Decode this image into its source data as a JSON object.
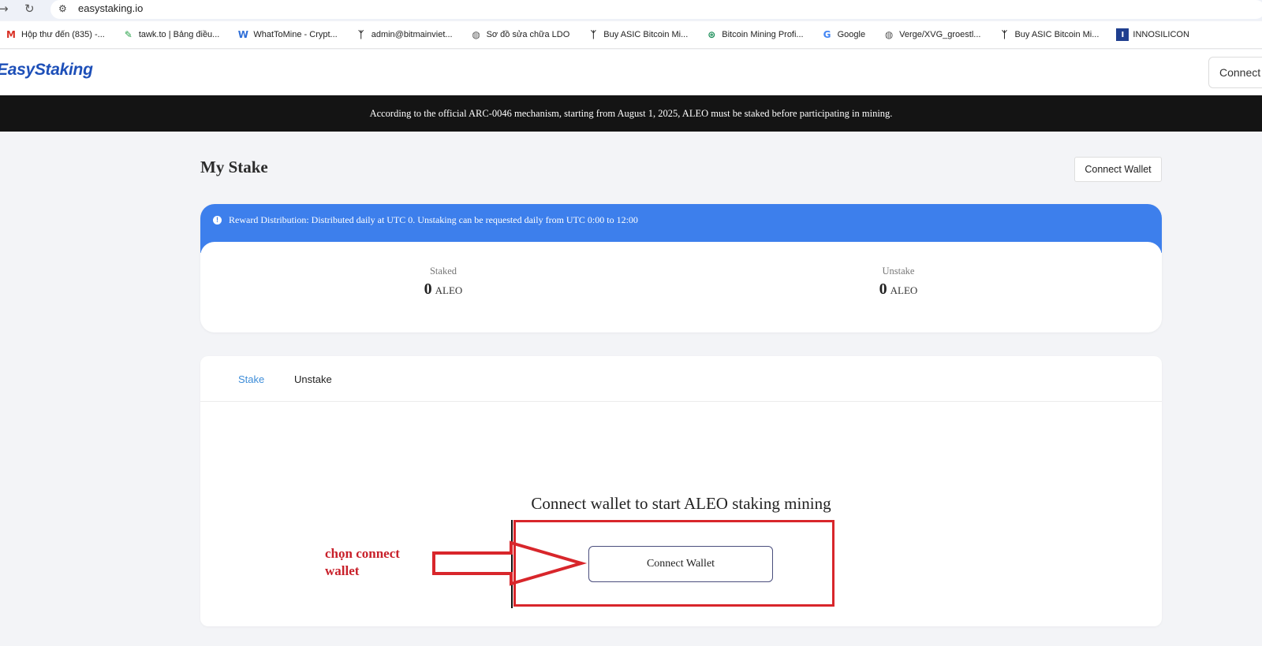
{
  "browser": {
    "url": "easystaking.io",
    "bookmarks": [
      {
        "icon": "gmail-icon",
        "label": "Hộp thư đến (835) -...",
        "color": "#d93025"
      },
      {
        "icon": "tawk-icon",
        "label": "tawk.to | Bảng điều...",
        "color": "#2aa24a"
      },
      {
        "icon": "whattomine-icon",
        "label": "WhatToMine - Crypt...",
        "color": "#2f6fd8"
      },
      {
        "icon": "bitmain-icon",
        "label": "admin@bitmainviet...",
        "color": "#222222"
      },
      {
        "icon": "globe-icon",
        "label": "Sơ đồ sửa chữa LDO",
        "color": "#555555"
      },
      {
        "icon": "bitmain-icon",
        "label": "Buy ASIC Bitcoin Mi...",
        "color": "#222222"
      },
      {
        "icon": "mining-profit-icon",
        "label": "Bitcoin Mining Profi...",
        "color": "#1e8f5a"
      },
      {
        "icon": "google-icon",
        "label": "Google",
        "color": "#4285f4"
      },
      {
        "icon": "globe-icon",
        "label": "Verge/XVG_groestl...",
        "color": "#555555"
      },
      {
        "icon": "bitmain-icon",
        "label": "Buy ASIC Bitcoin Mi...",
        "color": "#222222"
      },
      {
        "icon": "innosilicon-icon",
        "label": "INNOSILICON",
        "color": "#1f3f8f"
      }
    ]
  },
  "header": {
    "logo": "EasyStaking",
    "connect_label": "Connect"
  },
  "banner": {
    "text": "According to the official ARC-0046 mechanism, starting from August 1, 2025, ALEO must be staked before participating in mining."
  },
  "stake": {
    "title": "My Stake",
    "connect_label": "Connect Wallet",
    "reward_info": "Reward Distribution: Distributed daily at UTC 0. Unstaking can be requested daily from UTC 0:00 to 12:00",
    "staked_label": "Staked",
    "staked_value": "0",
    "unstake_label": "Unstake",
    "unstake_value": "0",
    "unit": "ALEO"
  },
  "tabs": {
    "stake": "Stake",
    "unstake": "Unstake"
  },
  "panel": {
    "cta_text": "Connect wallet to start ALEO staking mining",
    "connect_label": "Connect Wallet"
  },
  "annotation": {
    "line1": "chọn connect",
    "line2": "wallet",
    "color": "#d8262b"
  },
  "colors": {
    "accent_blue": "#3d7fec",
    "tab_active": "#3e8dd8",
    "logo": "#1d4fb8",
    "banner_bg": "#141414"
  }
}
